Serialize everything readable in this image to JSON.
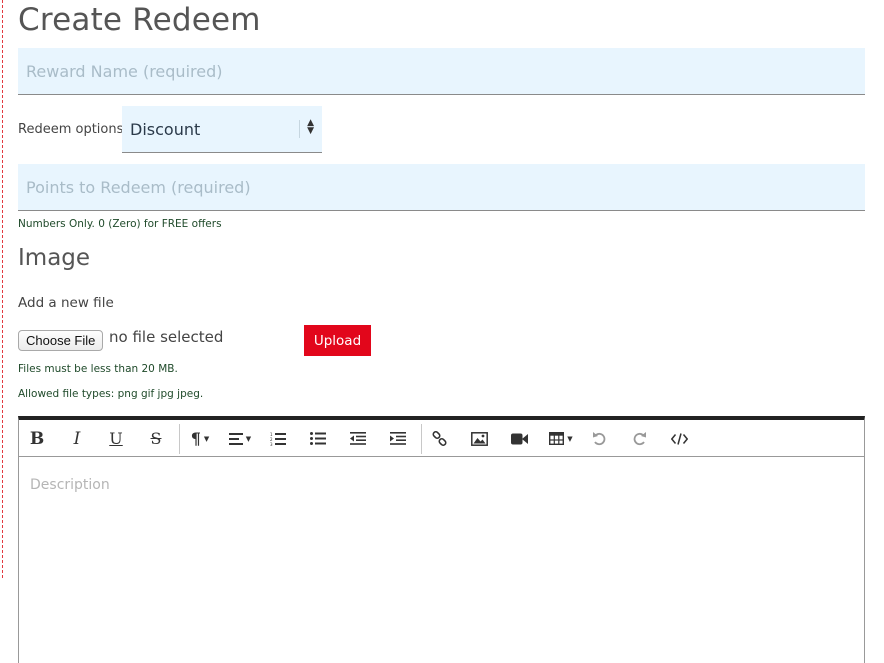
{
  "page": {
    "title": "Create Redeem"
  },
  "form": {
    "reward_placeholder": "Reward Name (required)",
    "redeem_label": "Redeem options",
    "redeem_selected": "Discount",
    "points_placeholder": "Points to Redeem (required)",
    "points_hint": "Numbers Only. 0 (Zero) for FREE offers"
  },
  "image": {
    "heading": "Image",
    "add_label": "Add a new file",
    "choose_label": "Choose File",
    "no_file_text": "no file selected",
    "upload_label": "Upload",
    "size_hint": "Files must be less than 20 MB.",
    "types_hint": "Allowed file types: png gif jpg jpeg."
  },
  "editor": {
    "description_placeholder": "Description",
    "toolbar_icons": [
      "bold-icon",
      "italic-icon",
      "underline-icon",
      "strikethrough-icon",
      "paragraph-icon",
      "align-icon",
      "ordered-list-icon",
      "unordered-list-icon",
      "outdent-icon",
      "indent-icon",
      "link-icon",
      "image-icon",
      "video-icon",
      "table-icon",
      "undo-icon",
      "redo-icon",
      "code-view-icon"
    ]
  },
  "colors": {
    "field_background": "#e8f5fe",
    "upload_button": "#e2061b",
    "hint_text": "#1f4a2a",
    "page_border": "#e2393f"
  }
}
